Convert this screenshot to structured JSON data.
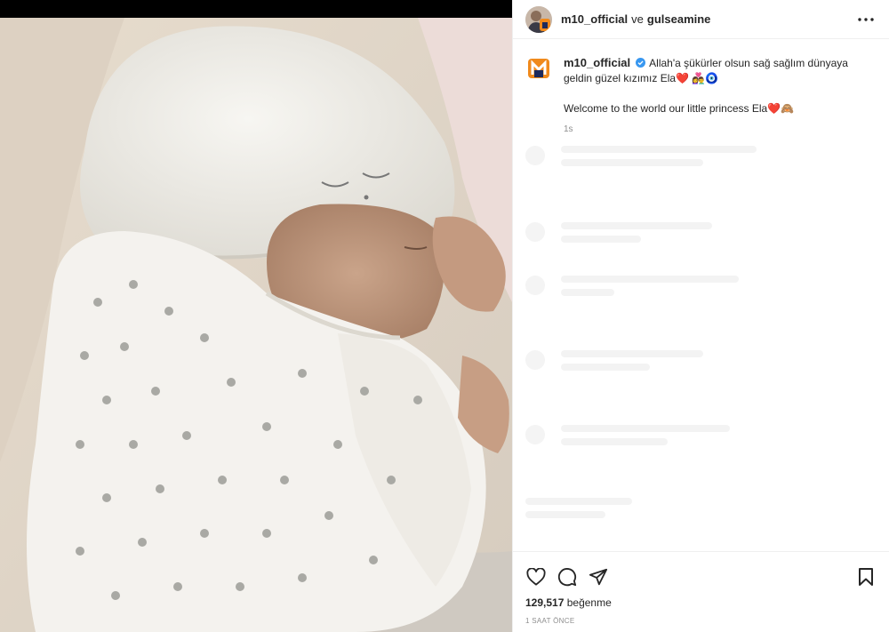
{
  "post": {
    "author": "m10_official",
    "joiner": "ve",
    "collaborator": "gulseamine",
    "caption_user": "m10_official",
    "caption_line1": "Allah'a şükürler olsun sağ sağlım dünyaya geldin güzel kızımız Ela❤️ 👩‍❤️‍👨🧿",
    "caption_line2": "Welcome to the world our little princess Ela❤️🙈",
    "caption_time": "1s",
    "likes_count": "129,517",
    "likes_label": "beğenme",
    "posted_ago": "1 SAAT ÖNCE"
  },
  "icons": {
    "more": "more-horizontal-icon",
    "like": "heart-icon",
    "comment": "comment-icon",
    "share": "share-icon",
    "save": "bookmark-icon",
    "verified": "verified-badge-icon"
  },
  "colors": {
    "verified": "#3897f0",
    "logo_orange": "#f08a1c",
    "logo_navy": "#1d2a5c"
  }
}
